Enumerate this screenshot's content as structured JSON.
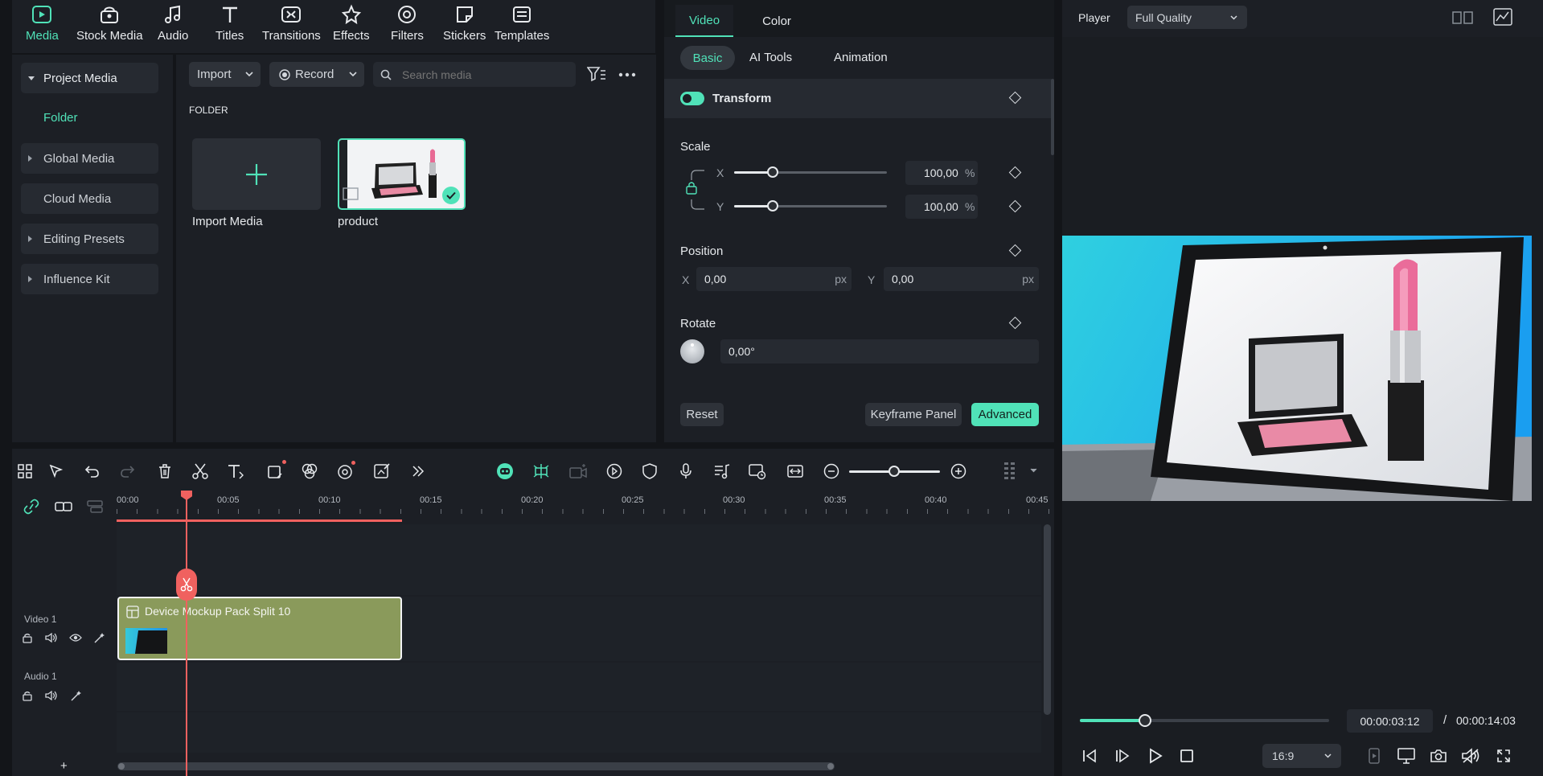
{
  "toolbar": {
    "items": [
      {
        "label": "Media",
        "icon": "media-icon"
      },
      {
        "label": "Stock Media",
        "icon": "stock-media-icon"
      },
      {
        "label": "Audio",
        "icon": "audio-icon"
      },
      {
        "label": "Titles",
        "icon": "titles-icon"
      },
      {
        "label": "Transitions",
        "icon": "transitions-icon"
      },
      {
        "label": "Effects",
        "icon": "effects-icon"
      },
      {
        "label": "Filters",
        "icon": "filters-icon"
      },
      {
        "label": "Stickers",
        "icon": "stickers-icon"
      },
      {
        "label": "Templates",
        "icon": "templates-icon"
      }
    ],
    "active": "Media"
  },
  "sidebar": {
    "items": [
      {
        "label": "Project Media"
      },
      {
        "label": "Folder"
      },
      {
        "label": "Global Media"
      },
      {
        "label": "Cloud Media"
      },
      {
        "label": "Editing Presets"
      },
      {
        "label": "Influence Kit"
      }
    ]
  },
  "media": {
    "import_label": "Import",
    "record_label": "Record",
    "search_placeholder": "Search media",
    "folder_heading": "FOLDER",
    "import_media_label": "Import Media",
    "product_label": "product"
  },
  "inspector": {
    "tabs": [
      "Video",
      "Color"
    ],
    "subtabs": [
      "Basic",
      "AI Tools",
      "Animation"
    ],
    "transform_label": "Transform",
    "scale_label": "Scale",
    "scale_x": "100,00",
    "scale_y": "100,00",
    "scale_unit": "%",
    "axis_x": "X",
    "axis_y": "Y",
    "position_label": "Position",
    "pos_x": "0,00",
    "pos_y": "0,00",
    "pos_unit": "px",
    "rotate_label": "Rotate",
    "rotate_value": "0,00°",
    "reset_label": "Reset",
    "keyframe_label": "Keyframe Panel",
    "advanced_label": "Advanced",
    "scale_level": 0.25
  },
  "player": {
    "label": "Player",
    "quality": "Full Quality",
    "current_time": "00:00:03:12",
    "separator": "/",
    "total_time": "00:00:14:03",
    "aspect": "16:9",
    "progress": 0.26
  },
  "timeline": {
    "ticks": [
      "00:00",
      "00:05",
      "00:10",
      "00:15",
      "00:20",
      "00:25",
      "00:30",
      "00:35",
      "00:40",
      "00:45"
    ],
    "video_track": "Video 1",
    "audio_track": "Audio 1",
    "clip_label": "Device Mockup Pack Split 10",
    "add_label": "+"
  },
  "colors": {
    "accent": "#50e2b8",
    "playhead": "#f0615f",
    "clip": "#8a9a5b",
    "panel": "#1c1f25"
  }
}
